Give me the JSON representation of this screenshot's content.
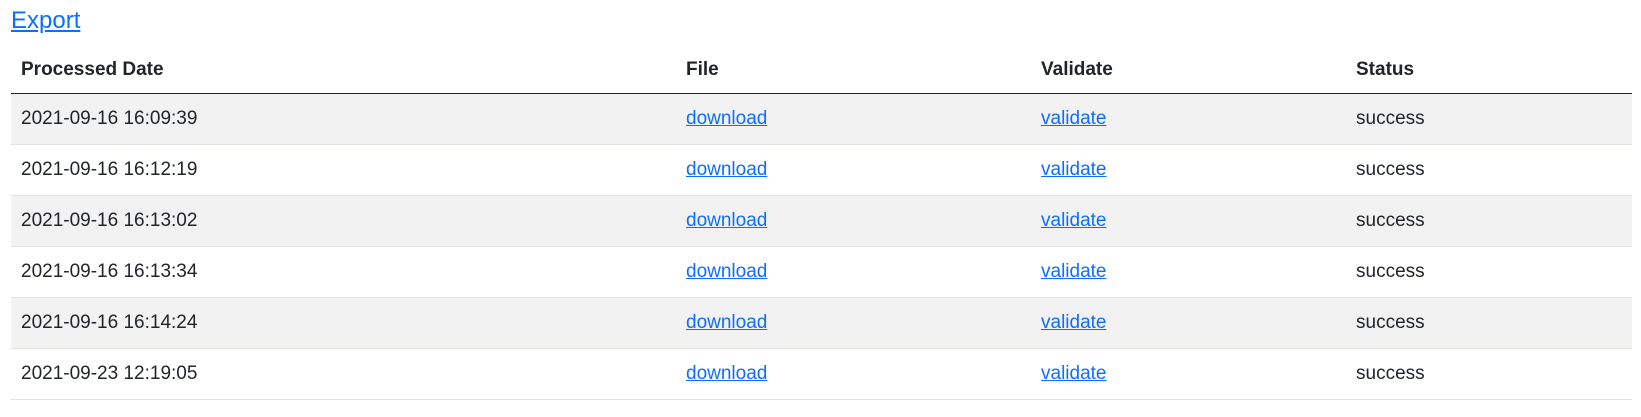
{
  "export_label": "Export",
  "table": {
    "headers": {
      "processed_date": "Processed Date",
      "file": "File",
      "validate": "Validate",
      "status": "Status"
    },
    "rows": [
      {
        "date": "2021-09-16 16:09:39",
        "file": "download",
        "validate": "validate",
        "status": "success"
      },
      {
        "date": "2021-09-16 16:12:19",
        "file": "download",
        "validate": "validate",
        "status": "success"
      },
      {
        "date": "2021-09-16 16:13:02",
        "file": "download",
        "validate": "validate",
        "status": "success"
      },
      {
        "date": "2021-09-16 16:13:34",
        "file": "download",
        "validate": "validate",
        "status": "success"
      },
      {
        "date": "2021-09-16 16:14:24",
        "file": "download",
        "validate": "validate",
        "status": "success"
      },
      {
        "date": "2021-09-23 12:19:05",
        "file": "download",
        "validate": "validate",
        "status": "success"
      }
    ]
  },
  "colors": {
    "link": "#0d6efd",
    "text": "#212529",
    "stripe": "#f2f2f2"
  }
}
